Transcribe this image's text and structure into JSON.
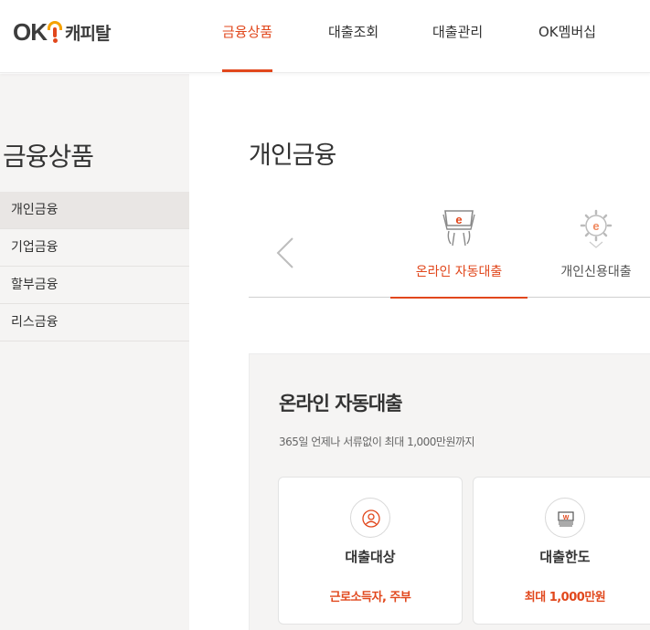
{
  "brand": {
    "logo_prefix": "OK",
    "logo_text": "캐피탈",
    "accent_color": "#e1471c",
    "logo_yellow": "#f5a200"
  },
  "gnb": {
    "items": [
      {
        "label": "금융상품",
        "active": true
      },
      {
        "label": "대출조회",
        "active": false
      },
      {
        "label": "대출관리",
        "active": false
      },
      {
        "label": "OK멤버십",
        "active": false
      }
    ]
  },
  "sidebar": {
    "title": "금융상품",
    "items": [
      {
        "label": "개인금융",
        "active": true
      },
      {
        "label": "기업금융",
        "active": false
      },
      {
        "label": "할부금융",
        "active": false
      },
      {
        "label": "리스금융",
        "active": false
      }
    ]
  },
  "main": {
    "title": "개인금융",
    "carousel": {
      "prev_icon": "chevron-left-icon",
      "tabs": [
        {
          "label": "온라인 자동대출",
          "icon": "online-loan-icon",
          "active": true
        },
        {
          "label": "개인신용대출",
          "icon": "gear-e-icon",
          "active": false
        }
      ]
    },
    "product": {
      "name": "온라인 자동대출",
      "description": "365일 언제나 서류없이 최대 1,000만원까지",
      "cards": [
        {
          "title": "대출대상",
          "value": "근로소득자, 주부",
          "icon": "person-icon"
        },
        {
          "title": "대출한도",
          "value": "최대 1,000만원",
          "icon": "money-icon"
        }
      ]
    }
  }
}
